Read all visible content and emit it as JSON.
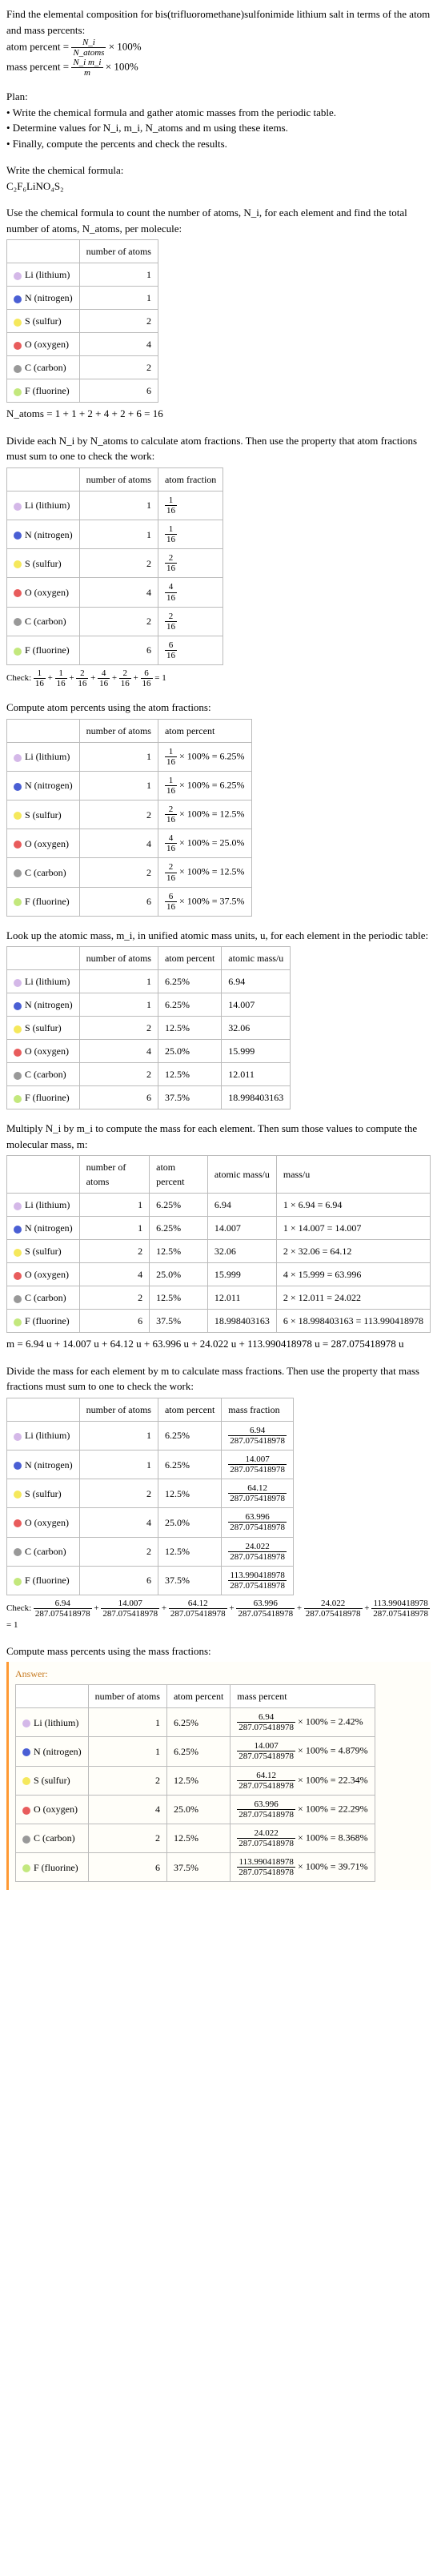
{
  "intro": {
    "title": "Find the elemental composition for bis(trifluoromethane)sulfonimide lithium salt in terms of the atom and mass percents:",
    "atom_percent_lhs": "atom percent =",
    "atom_percent_rhs": " × 100%",
    "mass_percent_lhs": "mass percent =",
    "mass_percent_rhs": " × 100%",
    "frac_atom_num": "N_i",
    "frac_atom_den": "N_atoms",
    "frac_mass_num": "N_i m_i",
    "frac_mass_den": "m"
  },
  "plan": {
    "heading": "Plan:",
    "b1": "• Write the chemical formula and gather atomic masses from the periodic table.",
    "b2": "• Determine values for N_i, m_i, N_atoms and m using these items.",
    "b3": "• Finally, compute the percents and check the results."
  },
  "writeformula": {
    "heading": "Write the chemical formula:",
    "formula": "C₂F₆LiNO₄S₂"
  },
  "countatoms": {
    "heading": "Use the chemical formula to count the number of atoms, N_i, for each element and find the total number of atoms, N_atoms, per molecule:",
    "col0": "",
    "col1": "number of atoms",
    "total": "N_atoms = 1 + 1 + 2 + 4 + 2 + 6 = 16"
  },
  "atomfrac": {
    "heading": "Divide each N_i by N_atoms to calculate atom fractions. Then use the property that atom fractions must sum to one to check the work:",
    "col2": "atom fraction",
    "check_lhs": "Check: ",
    "check_rhs": " = 1"
  },
  "atompct": {
    "heading": "Compute atom percents using the atom fractions:",
    "col2": "atom percent"
  },
  "atomicmass": {
    "heading": "Look up the atomic mass, m_i, in unified atomic mass units, u, for each element in the periodic table:",
    "col3": "atomic mass/u"
  },
  "massmul": {
    "heading": "Multiply N_i by m_i to compute the mass for each element. Then sum those values to compute the molecular mass, m:",
    "col4": "mass/u",
    "sum": "m = 6.94 u + 14.007 u + 64.12 u + 63.996 u + 24.022 u + 113.990418978 u = 287.075418978 u"
  },
  "massfrac": {
    "heading": "Divide the mass for each element by m to calculate mass fractions. Then use the property that mass fractions must sum to one to check the work:",
    "col2": "mass fraction",
    "check_lhs": "Check: ",
    "check_rhs": " = 1"
  },
  "masspct": {
    "heading": "Compute mass percents using the mass fractions:",
    "answer": "Answer:",
    "col2": "mass percent"
  },
  "elements": [
    {
      "key": "li",
      "sym": "Li",
      "name": "(lithium)",
      "n": 1,
      "frac_n": "1",
      "frac_d": "16",
      "pct": "6.25%",
      "amass": "6.94",
      "mul": "1 × 6.94 = 6.94",
      "mfrac_n": "6.94",
      "mfrac_d": "287.075418978",
      "mpct_n": "6.94",
      "mpct": "× 100% = 2.42%"
    },
    {
      "key": "n",
      "sym": "N",
      "name": "(nitrogen)",
      "n": 1,
      "frac_n": "1",
      "frac_d": "16",
      "pct": "6.25%",
      "amass": "14.007",
      "mul": "1 × 14.007 = 14.007",
      "mfrac_n": "14.007",
      "mfrac_d": "287.075418978",
      "mpct_n": "14.007",
      "mpct": "× 100% = 4.879%"
    },
    {
      "key": "s",
      "sym": "S",
      "name": "(sulfur)",
      "n": 2,
      "frac_n": "2",
      "frac_d": "16",
      "pct": "12.5%",
      "amass": "32.06",
      "mul": "2 × 32.06 = 64.12",
      "mfrac_n": "64.12",
      "mfrac_d": "287.075418978",
      "mpct_n": "64.12",
      "mpct": "× 100% = 22.34%"
    },
    {
      "key": "o",
      "sym": "O",
      "name": "(oxygen)",
      "n": 4,
      "frac_n": "4",
      "frac_d": "16",
      "pct": "25.0%",
      "amass": "15.999",
      "mul": "4 × 15.999 = 63.996",
      "mfrac_n": "63.996",
      "mfrac_d": "287.075418978",
      "mpct_n": "63.996",
      "mpct": "× 100% = 22.29%"
    },
    {
      "key": "c",
      "sym": "C",
      "name": "(carbon)",
      "n": 2,
      "frac_n": "2",
      "frac_d": "16",
      "pct": "12.5%",
      "amass": "12.011",
      "mul": "2 × 12.011 = 24.022",
      "mfrac_n": "24.022",
      "mfrac_d": "287.075418978",
      "mpct_n": "24.022",
      "mpct": "× 100% = 8.368%"
    },
    {
      "key": "f",
      "sym": "F",
      "name": "(fluorine)",
      "n": 6,
      "frac_n": "6",
      "frac_d": "16",
      "pct": "37.5%",
      "amass": "18.998403163",
      "mul": "6 × 18.998403163 = 113.990418978",
      "mfrac_n": "113.990418978",
      "mfrac_d": "287.075418978",
      "mpct_n": "113.990418978",
      "mpct": "× 100% = 39.71%"
    }
  ],
  "check_atom_fracs": [
    "1",
    "1",
    "2",
    "4",
    "2",
    "6"
  ],
  "check_mass_fracs": [
    "6.94",
    "14.007",
    "64.12",
    "63.996",
    "24.022",
    "113.990418978"
  ],
  "den16": "16",
  "denM": "287.075418978"
}
